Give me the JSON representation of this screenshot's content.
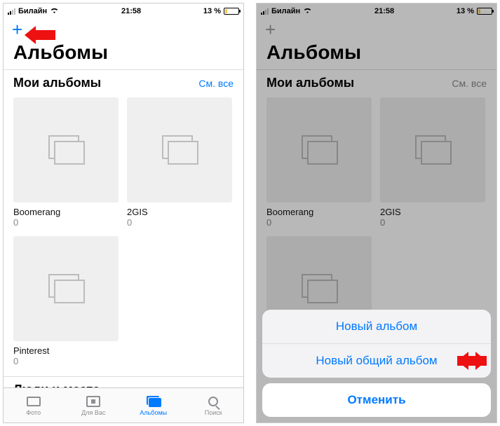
{
  "status": {
    "carrier": "Билайн",
    "time": "21:58",
    "battery_pct": "13 %"
  },
  "left_screen": {
    "title": "Альбомы",
    "section_my_albums": "Мои альбомы",
    "see_all": "См. все",
    "albums": [
      {
        "name": "Boomerang",
        "count": "0"
      },
      {
        "name": "2GIS",
        "count": "0"
      },
      {
        "name": "Pinterest",
        "count": "0"
      }
    ],
    "section_people_places": "Люди и места"
  },
  "tabs": {
    "photo": "Фото",
    "for_you": "Для Вас",
    "albums": "Альбомы",
    "search": "Поиск"
  },
  "right_screen": {
    "title": "Альбомы",
    "section_my_albums": "Мои альбомы",
    "see_all": "См. все",
    "albums": [
      {
        "name": "Boomerang",
        "count": "0"
      },
      {
        "name": "2GIS",
        "count": "0"
      }
    ]
  },
  "action_sheet": {
    "new_album": "Новый альбом",
    "new_shared_album": "Новый общий альбом",
    "cancel": "Отменить"
  }
}
